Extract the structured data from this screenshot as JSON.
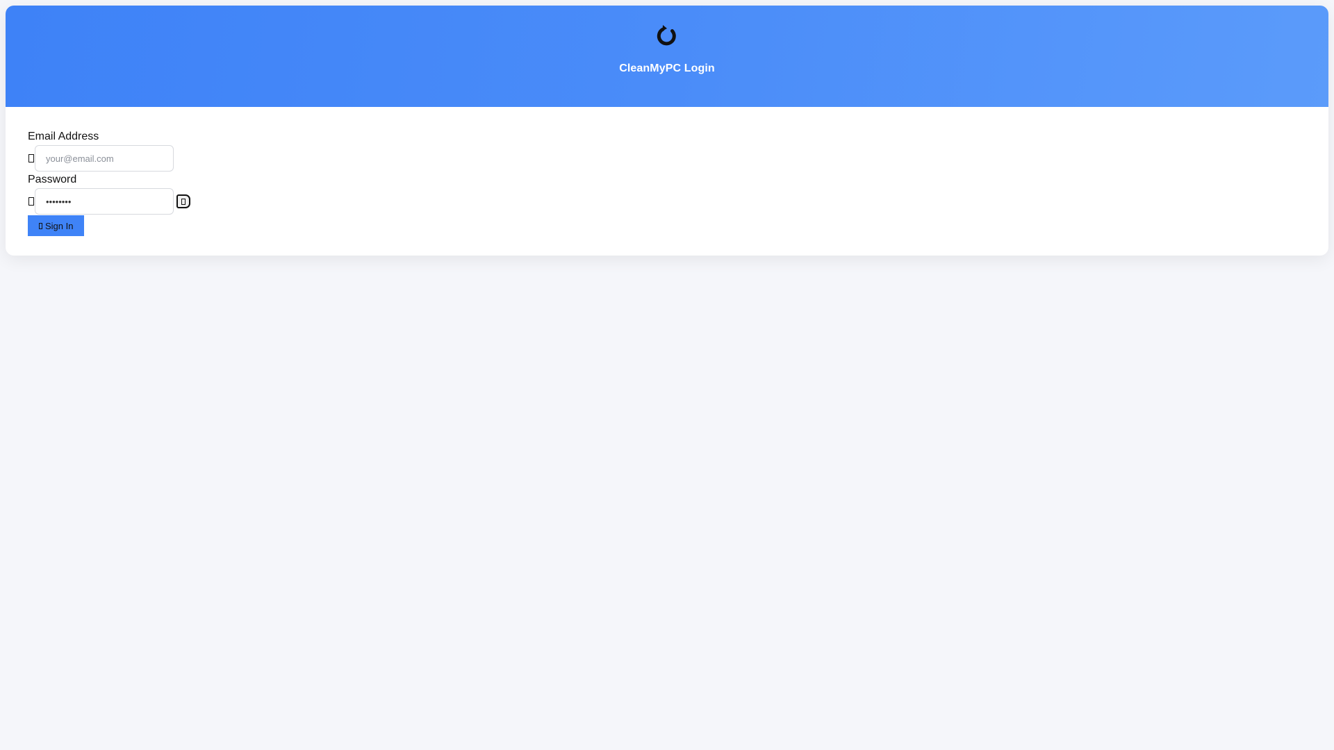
{
  "header": {
    "logo_icon": "refresh-icon",
    "title": "CleanMyPC Login",
    "gradient_start": "#3e82f7",
    "gradient_end": "#5b9bfa"
  },
  "form": {
    "email": {
      "label": "Email Address",
      "placeholder": "your@email.com",
      "value": "",
      "icon": "email-icon"
    },
    "password": {
      "label": "Password",
      "value": "••••••••",
      "icon": "lock-icon",
      "toggle_icon": "eye-icon"
    },
    "submit": {
      "label": "Sign In",
      "icon": "sign-in-icon",
      "color": "#3f83f7"
    }
  }
}
